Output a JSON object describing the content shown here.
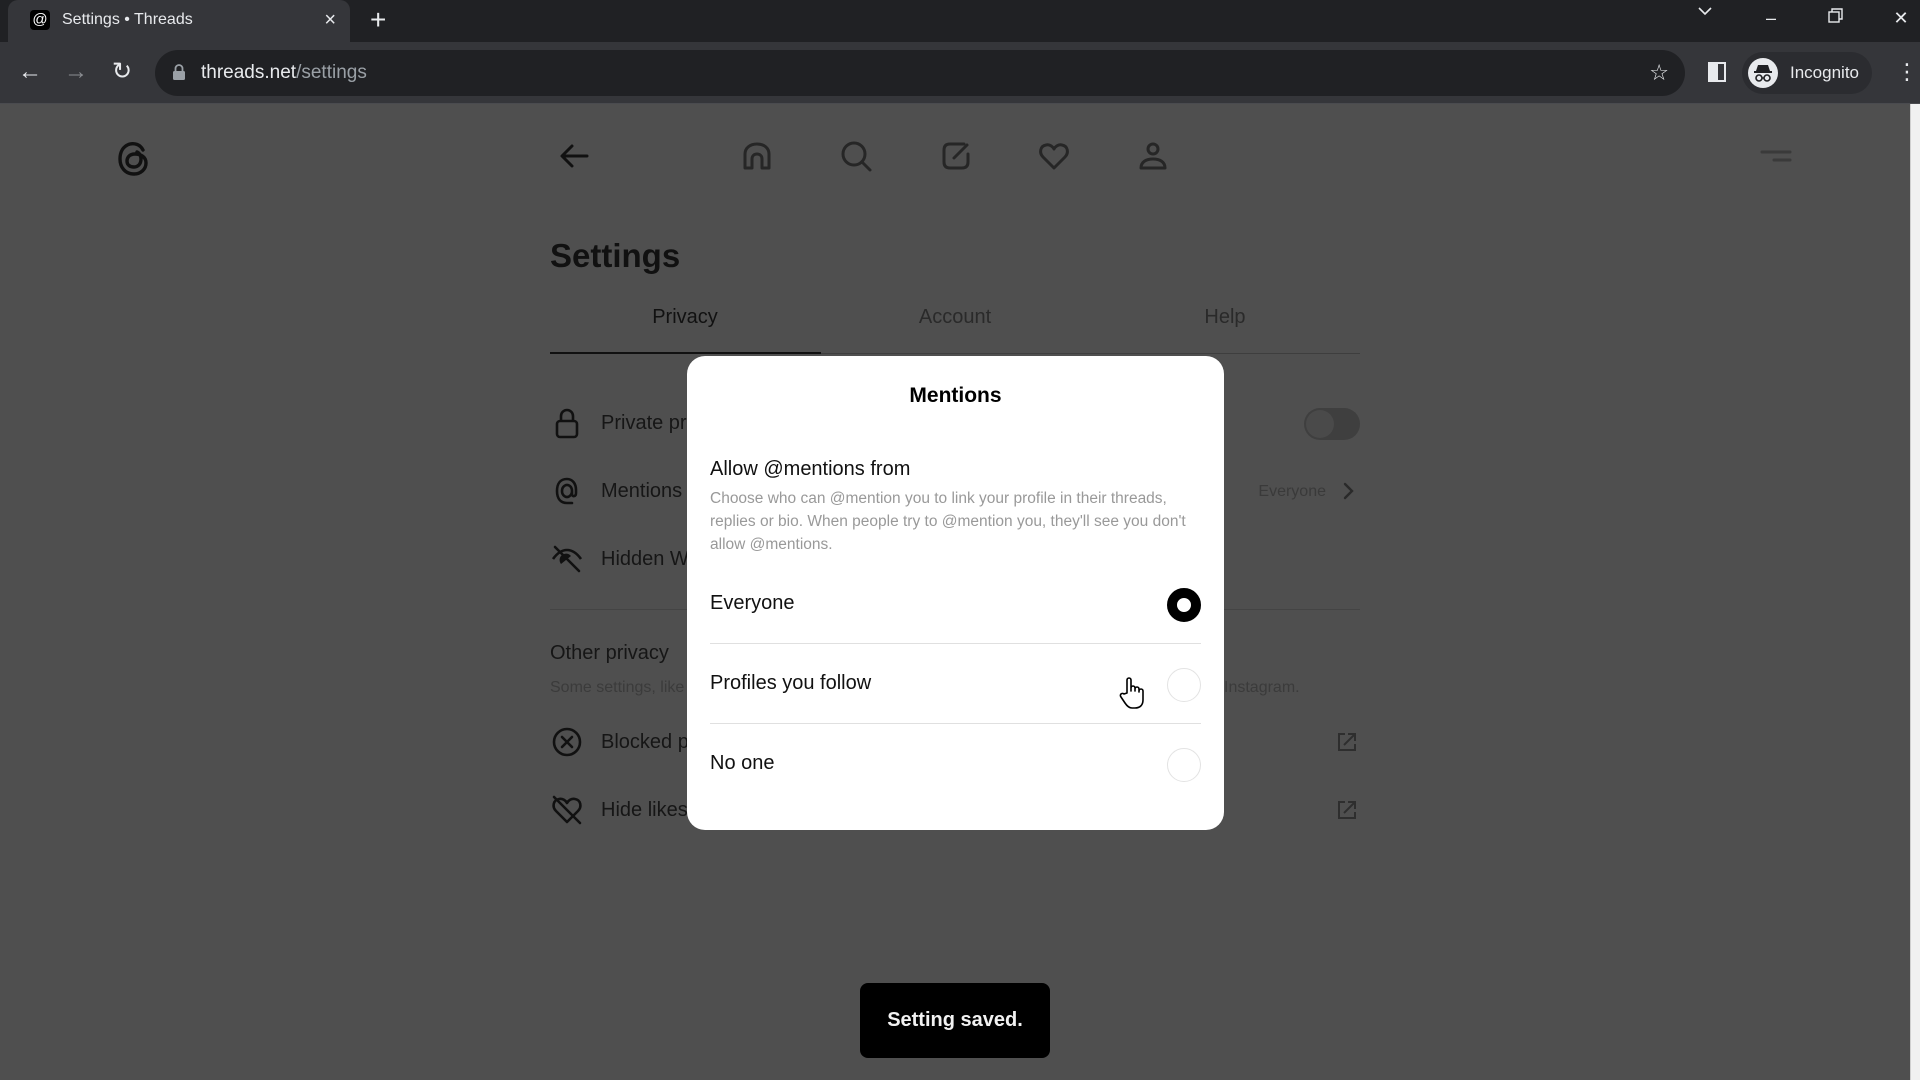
{
  "browser": {
    "tab_title": "Settings • Threads",
    "tab_close": "×",
    "new_tab": "+",
    "url_host": "threads.net",
    "url_path": "/settings",
    "profile_label": "Incognito",
    "window_controls": {
      "tab_search": "⌄",
      "minimize": "–",
      "restore": "❐",
      "close": "✕"
    },
    "nav": {
      "back": "←",
      "forward": "→",
      "reload": "↻"
    },
    "bookmark_star": "☆",
    "menu": "⋮"
  },
  "app": {
    "nav_icons": [
      "home-icon",
      "search-icon",
      "compose-icon",
      "heart-icon",
      "profile-icon"
    ],
    "settings_title": "Settings",
    "tabs": [
      {
        "label": "Privacy",
        "active": true
      },
      {
        "label": "Account",
        "active": false
      },
      {
        "label": "Help",
        "active": false
      }
    ],
    "privacy_rows": [
      {
        "icon": "lock-icon",
        "label": "Private profile",
        "visible_label": "Private pr",
        "control": "toggle",
        "toggle_on": false
      },
      {
        "icon": "at-sign-icon",
        "label": "Mentions",
        "visible_label": "Mentions",
        "value": "Everyone",
        "control": "chevron"
      },
      {
        "icon": "eye-off-icon",
        "label": "Hidden Words",
        "visible_label": "Hidden W",
        "control": "none"
      }
    ],
    "other_privacy": {
      "title": "Other privacy settings",
      "visible_title": "Other privacy",
      "subtitle_left": "Some settings, like",
      "subtitle_right": "Instagram.",
      "rows": [
        {
          "icon": "blocked-icon",
          "label": "Blocked profiles",
          "visible_label": "Blocked p",
          "control": "external-link"
        },
        {
          "icon": "heart-off-icon",
          "label": "Hide likes",
          "visible_label": "Hide likes",
          "control": "external-link"
        }
      ]
    }
  },
  "modal": {
    "title": "Mentions",
    "heading": "Allow @mentions from",
    "description": "Choose who can @mention you to link your profile in their threads, replies or bio. When people try to @mention you, they'll see you don't allow @mentions.",
    "options": [
      {
        "label": "Everyone",
        "selected": true
      },
      {
        "label": "Profiles you follow",
        "selected": false
      },
      {
        "label": "No one",
        "selected": false
      }
    ]
  },
  "toast": {
    "message": "Setting saved."
  }
}
